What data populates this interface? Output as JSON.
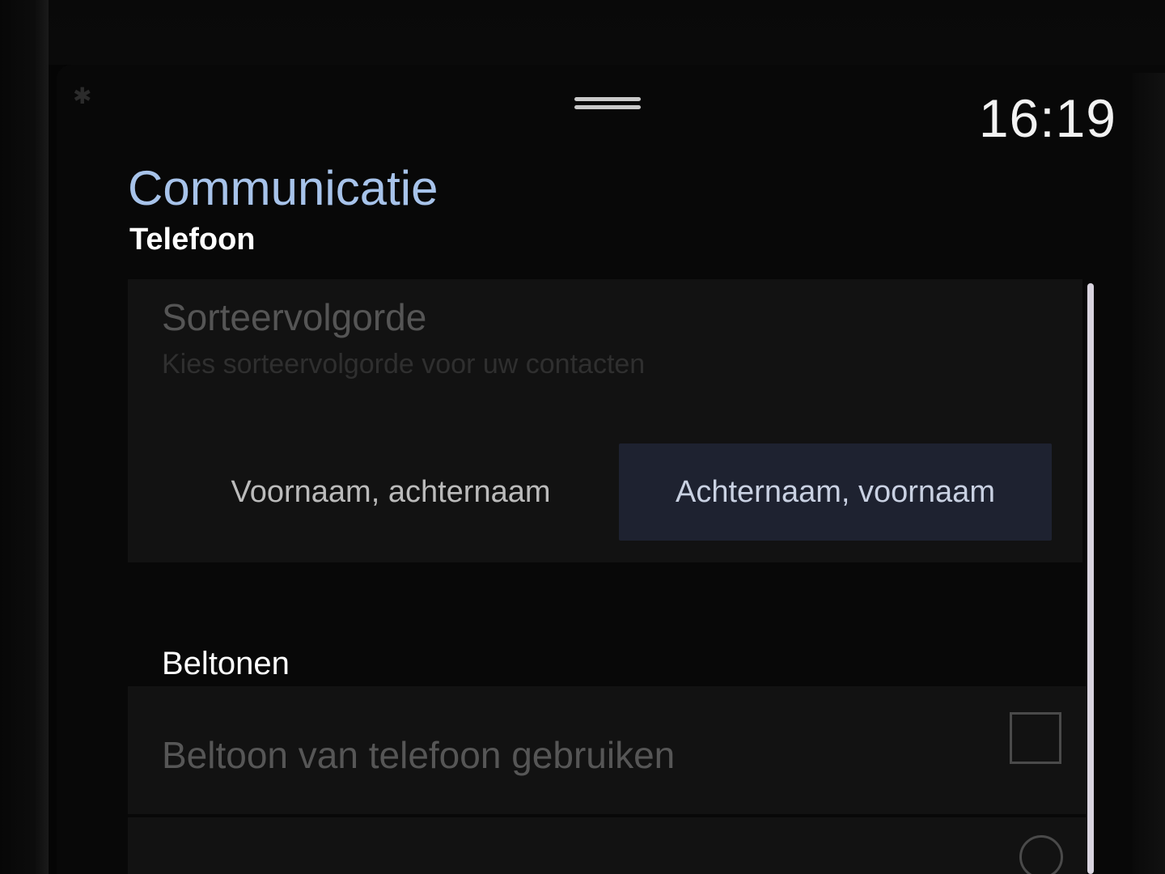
{
  "status_bar": {
    "clock": "16:19",
    "bluetooth_icon": "bluetooth-icon",
    "handle_icon": "drag-handle-icon"
  },
  "header": {
    "title": "Communicatie",
    "subtitle": "Telefoon"
  },
  "sort_order": {
    "title": "Sorteervolgorde",
    "description": "Kies sorteervolgorde voor uw contacten",
    "options": [
      {
        "label": "Voornaam, achternaam",
        "selected": false
      },
      {
        "label": "Achternaam, voornaam",
        "selected": true
      }
    ]
  },
  "ringtones": {
    "section_title": "Beltonen",
    "items": [
      {
        "label": "Beltoon van telefoon gebruiken",
        "control": "checkbox",
        "checked": false
      },
      {
        "label": "",
        "control": "radio",
        "checked": false
      }
    ]
  },
  "colors": {
    "title_accent": "#a7c3ea",
    "selected_option_bg": "#1e2230",
    "scrollbar": "#d9d4df"
  }
}
